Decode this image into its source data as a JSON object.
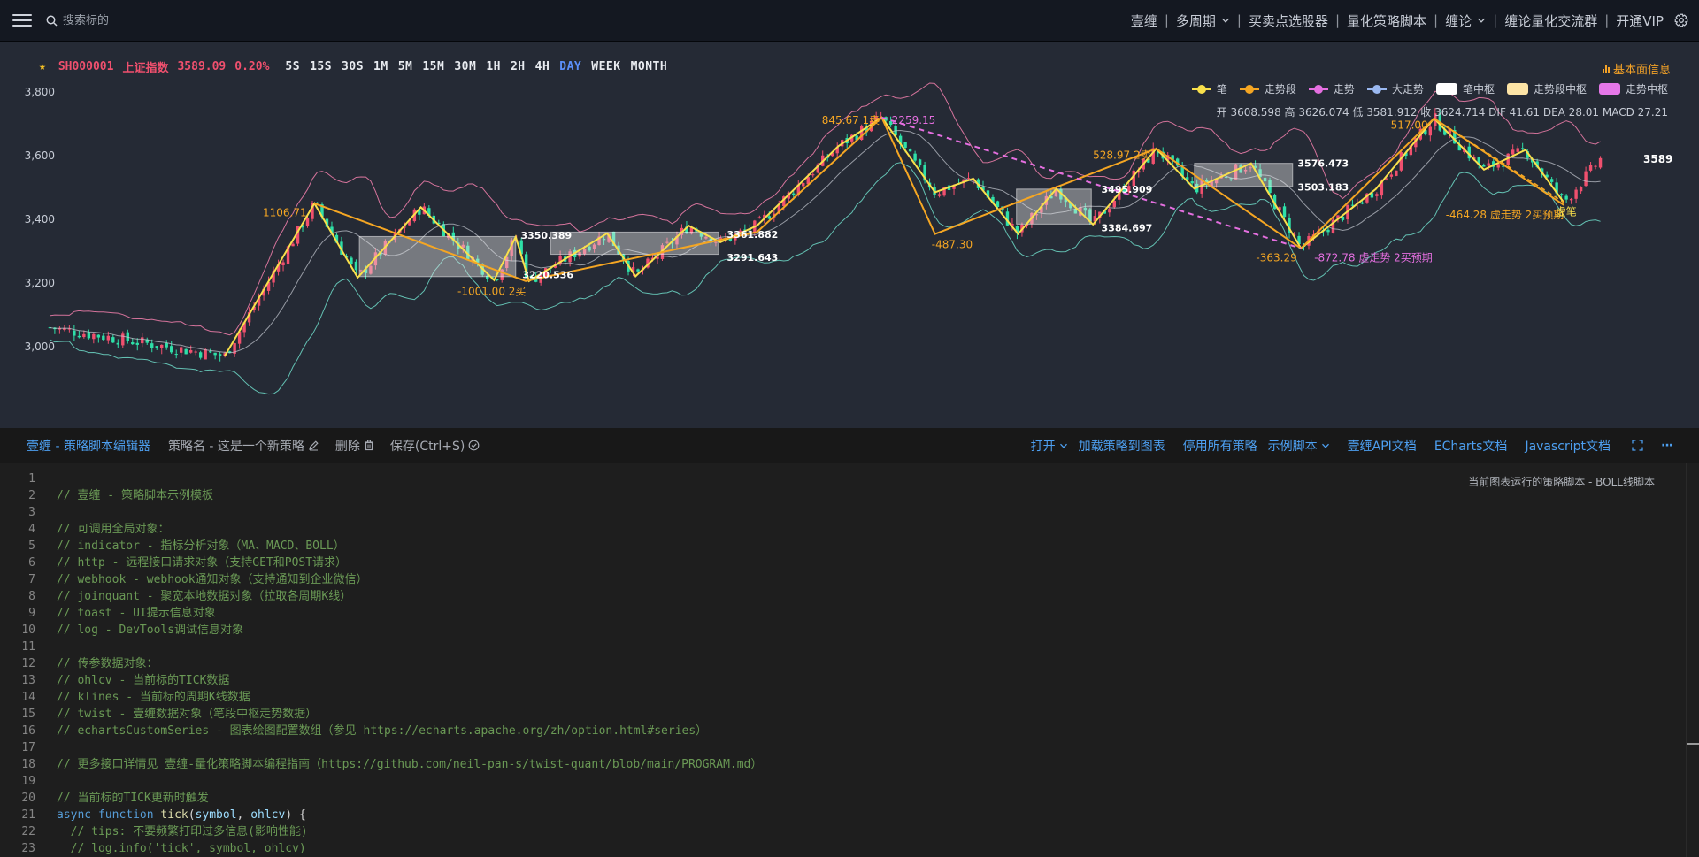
{
  "topbar": {
    "search_placeholder": "搜索标的",
    "menu": [
      {
        "label": "壹缠",
        "chevron": false
      },
      {
        "label": "多周期",
        "chevron": true
      },
      {
        "label": "买卖点选股器",
        "chevron": false
      },
      {
        "label": "量化策略脚本",
        "chevron": false
      },
      {
        "label": "缠论",
        "chevron": true
      },
      {
        "label": "缠论量化交流群",
        "chevron": false
      },
      {
        "label": "开通VIP",
        "chevron": false
      }
    ]
  },
  "chart": {
    "symbol_code": "SH000001",
    "symbol_name": "上证指数",
    "price": "3589.09",
    "change": "0.20%",
    "periods": [
      "5S",
      "15S",
      "30S",
      "1M",
      "5M",
      "15M",
      "30M",
      "1H",
      "2H",
      "4H",
      "DAY",
      "WEEK",
      "MONTH"
    ],
    "active_period": "DAY",
    "basic_info_label": "基本面信息",
    "legend": [
      {
        "label": "笔",
        "color": "#f9e04b",
        "kind": "line"
      },
      {
        "label": "走势段",
        "color": "#f5a623",
        "kind": "line"
      },
      {
        "label": "走势",
        "color": "#e56fe0",
        "kind": "line"
      },
      {
        "label": "大走势",
        "color": "#9ab8f0",
        "kind": "line"
      },
      {
        "label": "笔中枢",
        "color": "#ffffff",
        "kind": "box"
      },
      {
        "label": "走势段中枢",
        "color": "#fde4a6",
        "kind": "box"
      },
      {
        "label": "走势中枢",
        "color": "#e577e8",
        "kind": "box"
      }
    ],
    "ohlc_text": "开 3608.598 高 3626.074 低 3581.912 收 3624.714 DIF 41.61 DEA 28.01 MACD 27.21",
    "colors": {
      "up": "#f0506e",
      "down": "#2ee0a8",
      "bi": "#f9e04b",
      "seg": "#f5a623",
      "trend": "#e56fe0",
      "boll_upper": "#e87ba6",
      "boll_mid": "#c8ccd4",
      "boll_lower": "#6ad0c0"
    },
    "chart_data": {
      "type": "candlestick",
      "ylim": [
        2970,
        3880
      ],
      "y_ticks": [
        "3,800",
        "3,600",
        "3,400",
        "3,200",
        "3,000"
      ],
      "y_tick_values": [
        3800,
        3600,
        3400,
        3200,
        3000
      ],
      "last_price_label": "3589",
      "bi_points": [
        [
          0.135,
          2970
        ],
        [
          0.189,
          3450
        ],
        [
          0.215,
          3217
        ],
        [
          0.253,
          3438
        ],
        [
          0.297,
          3209
        ],
        [
          0.31,
          3345
        ],
        [
          0.318,
          3206
        ],
        [
          0.365,
          3356
        ],
        [
          0.382,
          3221
        ],
        [
          0.414,
          3380
        ],
        [
          0.433,
          3328
        ],
        [
          0.455,
          3380
        ],
        [
          0.504,
          3630
        ],
        [
          0.53,
          3720
        ],
        [
          0.562,
          3485
        ],
        [
          0.585,
          3528
        ],
        [
          0.612,
          3354
        ],
        [
          0.635,
          3496
        ],
        [
          0.657,
          3384
        ],
        [
          0.695,
          3622
        ],
        [
          0.718,
          3496
        ],
        [
          0.752,
          3576
        ],
        [
          0.782,
          3309
        ],
        [
          0.827,
          3495
        ],
        [
          0.862,
          3717
        ],
        [
          0.892,
          3556
        ],
        [
          0.917,
          3618
        ],
        [
          0.94,
          3453
        ]
      ],
      "seg_points": [
        [
          0.189,
          3450
        ],
        [
          0.316,
          3206
        ],
        [
          0.455,
          3360
        ],
        [
          0.53,
          3720
        ],
        [
          0.562,
          3354
        ],
        [
          0.695,
          3622
        ],
        [
          0.782,
          3309
        ],
        [
          0.862,
          3717
        ],
        [
          0.94,
          3445
        ]
      ],
      "trend_points": [
        [
          0.53,
          3720
        ],
        [
          0.782,
          3309
        ]
      ],
      "trend2_points": [
        [
          0.862,
          3717
        ],
        [
          0.94,
          3453
        ]
      ],
      "pivots": [
        {
          "x0": 0.216,
          "x1": 0.31,
          "y0": 3220,
          "y1": 3346
        },
        {
          "x0": 0.331,
          "x1": 0.432,
          "y0": 3290,
          "y1": 3360
        },
        {
          "x0": 0.611,
          "x1": 0.656,
          "y0": 3385,
          "y1": 3495
        },
        {
          "x0": 0.718,
          "x1": 0.777,
          "y0": 3503,
          "y1": 3576
        }
      ],
      "annotations": [
        {
          "text": "1106.71",
          "x": 0.158,
          "y": 3410,
          "color": "#f5a623"
        },
        {
          "text": "-1001.00 2买",
          "x": 0.275,
          "y": 3162,
          "color": "#f5a623"
        },
        {
          "text": "3350.389",
          "x": 0.313,
          "y": 3339,
          "color": "#ffffff"
        },
        {
          "text": "3220.536",
          "x": 0.314,
          "y": 3215,
          "color": "#ffffff"
        },
        {
          "text": "3361.882",
          "x": 0.437,
          "y": 3342,
          "color": "#ffffff"
        },
        {
          "text": "3291.643",
          "x": 0.437,
          "y": 3270,
          "color": "#ffffff"
        },
        {
          "text": "845.67 1卖",
          "x": 0.494,
          "y": 3700,
          "color": "#f5a623"
        },
        {
          "text": "2259.15",
          "x": 0.536,
          "y": 3700,
          "color": "#e56fe0"
        },
        {
          "text": "-487.30",
          "x": 0.56,
          "y": 3310,
          "color": "#f5a623"
        },
        {
          "text": "3495.909",
          "x": 0.662,
          "y": 3483,
          "color": "#ffffff"
        },
        {
          "text": "3384.697",
          "x": 0.662,
          "y": 3362,
          "color": "#ffffff"
        },
        {
          "text": "528.97 2卖",
          "x": 0.657,
          "y": 3590,
          "color": "#f5a623"
        },
        {
          "text": "3576.473",
          "x": 0.78,
          "y": 3565,
          "color": "#ffffff"
        },
        {
          "text": "3503.183",
          "x": 0.78,
          "y": 3490,
          "color": "#ffffff"
        },
        {
          "text": "-363.29",
          "x": 0.755,
          "y": 3268,
          "color": "#f5a623"
        },
        {
          "text": "-872.78 虚走势 2买预期",
          "x": 0.79,
          "y": 3268,
          "color": "#e56fe0"
        },
        {
          "text": "517.00",
          "x": 0.836,
          "y": 3685,
          "color": "#f5a623"
        },
        {
          "text": "-464.28 虚走势 2买预期",
          "x": 0.869,
          "y": 3403,
          "color": "#f5a623"
        },
        {
          "text": "虚笔",
          "x": 0.935,
          "y": 3413,
          "color": "#f9e04b"
        }
      ]
    }
  },
  "editor_toolbar": {
    "title": "壹缠 - 策略脚本编辑器",
    "strategy_name": "策略名 - 这是一个新策略",
    "delete_label": "删除",
    "save_label": "保存(Ctrl+S)",
    "open_label": "打开",
    "load_label": "加载策略到图表",
    "stop_label": "停用所有策略",
    "example_label": "示例脚本",
    "api_doc": "壹缠API文档",
    "echarts_doc": "ECharts文档",
    "js_doc": "Javascript文档",
    "more": "···"
  },
  "editor": {
    "run_tip": "当前图表运行的策略脚本 - BOLL线脚本",
    "lines": [
      "",
      "// 壹缠 - 策略脚本示例模板",
      "",
      "// 可调用全局对象：",
      "// indicator - 指标分析对象（MA、MACD、BOLL）",
      "// http - 远程接口请求对象（支持GET和POST请求）",
      "// webhook - webhook通知对象（支持通知到企业微信）",
      "// joinquant - 聚宽本地数据对象（拉取各周期K线）",
      "// toast - UI提示信息对象",
      "// log - DevTools调试信息对象",
      "",
      "// 传参数据对象：",
      "// ohlcv - 当前标的TICK数据",
      "// klines - 当前标的周期K线数据",
      "// twist - 壹缠数据对象（笔段中枢走势数据）",
      "// echartsCustomSeries - 图表绘图配置数组（参见 https://echarts.apache.org/zh/option.html#series）",
      "",
      "// 更多接口详情见 壹缠-量化策略脚本编程指南（https://github.com/neil-pan-s/twist-quant/blob/main/PROGRAM.md）",
      "",
      "// 当前标的TICK更新时触发",
      "async function tick(symbol, ohlcv) {",
      "  // tips: 不要频繁打印过多信息(影响性能)",
      "  // log.info('tick', symbol, ohlcv)"
    ],
    "line_numbers": [
      "1",
      "2",
      "3",
      "4",
      "5",
      "6",
      "7",
      "8",
      "9",
      "10",
      "11",
      "12",
      "13",
      "14",
      "15",
      "16",
      "17",
      "18",
      "19",
      "20",
      "21",
      "22",
      "23"
    ]
  }
}
